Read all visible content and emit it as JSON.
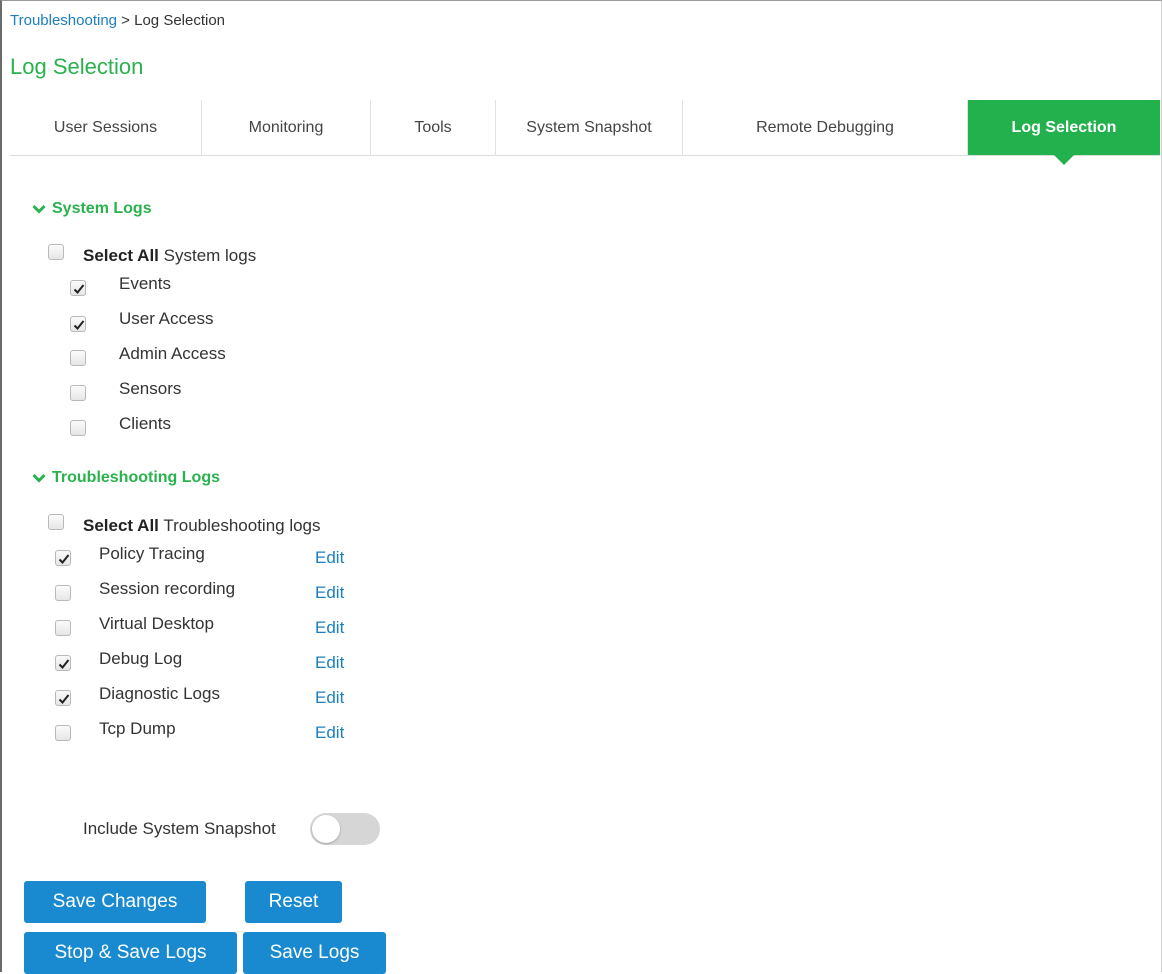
{
  "breadcrumb": {
    "parent": "Troubleshooting",
    "separator": " > ",
    "current": "Log Selection"
  },
  "page_title": "Log Selection",
  "tabs": [
    {
      "label": "User Sessions",
      "active": false
    },
    {
      "label": "Monitoring",
      "active": false
    },
    {
      "label": "Tools",
      "active": false
    },
    {
      "label": "System Snapshot",
      "active": false
    },
    {
      "label": "Remote Debugging",
      "active": false
    },
    {
      "label": "Log Selection",
      "active": true
    }
  ],
  "system_logs": {
    "title": "System Logs",
    "select_all": {
      "bold": "Select All",
      "rest": " System logs",
      "checked": false
    },
    "items": [
      {
        "label": "Events",
        "checked": true
      },
      {
        "label": "User Access",
        "checked": true
      },
      {
        "label": "Admin Access",
        "checked": false
      },
      {
        "label": "Sensors",
        "checked": false
      },
      {
        "label": "Clients",
        "checked": false
      }
    ]
  },
  "troubleshooting_logs": {
    "title": "Troubleshooting Logs",
    "select_all": {
      "bold": "Select All",
      "rest": " Troubleshooting logs",
      "checked": false
    },
    "edit_label": "Edit",
    "items": [
      {
        "label": "Policy Tracing",
        "checked": true
      },
      {
        "label": "Session recording",
        "checked": false
      },
      {
        "label": "Virtual Desktop",
        "checked": false
      },
      {
        "label": "Debug Log",
        "checked": true
      },
      {
        "label": "Diagnostic Logs",
        "checked": true
      },
      {
        "label": "Tcp Dump",
        "checked": false
      }
    ]
  },
  "snapshot_toggle": {
    "label": "Include System Snapshot",
    "on": false
  },
  "buttons": {
    "save_changes": "Save Changes",
    "reset": "Reset",
    "stop_save_logs": "Stop & Save Logs",
    "save_logs": "Save Logs"
  },
  "colors": {
    "accent_green": "#22b14c",
    "link_blue": "#1a7fc1",
    "button_blue": "#1a8ad0"
  }
}
